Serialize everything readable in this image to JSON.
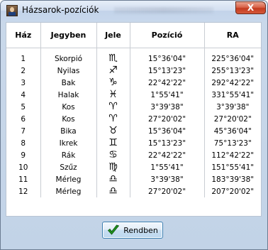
{
  "window": {
    "title": "Házsarok-pozíciók",
    "close_symbol": "X"
  },
  "table": {
    "headers": [
      "Ház",
      "Jegyben",
      "Jele",
      "Pozíció",
      "RA"
    ],
    "rows": [
      {
        "haz": "1",
        "jegy": "Skorpió",
        "jel": "♏",
        "poz": "15°36'04\"",
        "ra": "225°36'04\""
      },
      {
        "haz": "2",
        "jegy": "Nyilas",
        "jel": "♐",
        "poz": "15°13'23\"",
        "ra": "255°13'23\""
      },
      {
        "haz": "3",
        "jegy": "Bak",
        "jel": "♑",
        "poz": "22°42'22\"",
        "ra": "292°42'22\""
      },
      {
        "haz": "4",
        "jegy": "Halak",
        "jel": "♓",
        "poz": "1°55'41\"",
        "ra": "331°55'41\""
      },
      {
        "haz": "5",
        "jegy": "Kos",
        "jel": "♈",
        "poz": "3°39'38\"",
        "ra": "3°39'38\""
      },
      {
        "haz": "6",
        "jegy": "Kos",
        "jel": "♈",
        "poz": "27°20'02\"",
        "ra": "27°20'02\""
      },
      {
        "haz": "7",
        "jegy": "Bika",
        "jel": "♉",
        "poz": "15°36'04\"",
        "ra": "45°36'04\""
      },
      {
        "haz": "8",
        "jegy": "Ikrek",
        "jel": "♊",
        "poz": "15°13'23\"",
        "ra": "75°13'23\""
      },
      {
        "haz": "9",
        "jegy": "Rák",
        "jel": "♋",
        "poz": "22°42'22\"",
        "ra": "112°42'22\""
      },
      {
        "haz": "10",
        "jegy": "Szűz",
        "jel": "♍",
        "poz": "1°55'41\"",
        "ra": "151°55'41\""
      },
      {
        "haz": "11",
        "jegy": "Mérleg",
        "jel": "♎",
        "poz": "3°39'38\"",
        "ra": "183°39'38\""
      },
      {
        "haz": "12",
        "jegy": "Mérleg",
        "jel": "♎",
        "poz": "27°20'02\"",
        "ra": "207°20'02\""
      }
    ]
  },
  "footer": {
    "ok_label": "Rendben",
    "ok_icon": "checkmark-icon",
    "accent": "#1f8f1f"
  }
}
